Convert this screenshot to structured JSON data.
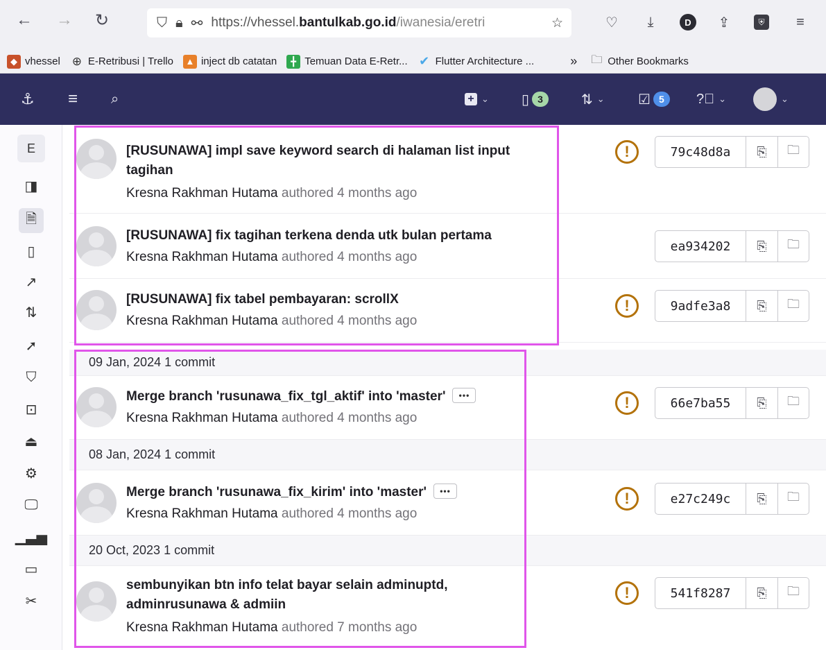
{
  "browser": {
    "url_prefix": "https://vhessel.",
    "url_host": "bantulkab.go.id",
    "url_path": "/iwanesia/eretri",
    "bookmarks": [
      {
        "label": "vhessel",
        "color": "#c8512a"
      },
      {
        "label": "E-Retribusi | Trello",
        "color": "#555555"
      },
      {
        "label": "inject db catatan",
        "color": "#e8802a"
      },
      {
        "label": "Temuan Data E-Retr...",
        "color": "#2fa84f"
      },
      {
        "label": "Flutter Architecture ...",
        "color": "#4aa8e8"
      }
    ],
    "overflow": "»",
    "other_bookmarks": "Other Bookmarks",
    "profile_letter": "D"
  },
  "gitlab": {
    "mr_count": "3",
    "todo_count": "5",
    "sidebar_project": "E"
  },
  "commits": [
    {
      "title_line1": "[RUSUNAWA] impl save keyword search di halaman list input",
      "title_line2": "tagihan",
      "author": "Kresna Rakhman Hutama",
      "authored": "authored 4 months ago",
      "sha": "79c48d8a",
      "pipeline": "warning"
    },
    {
      "title_line1": "[RUSUNAWA] fix tagihan terkena denda utk bulan pertama",
      "author": "Kresna Rakhman Hutama",
      "authored": "authored 4 months ago",
      "sha": "ea934202",
      "pipeline": "none"
    },
    {
      "title_line1": "[RUSUNAWA] fix tabel pembayaran: scrollX",
      "author": "Kresna Rakhman Hutama",
      "authored": "authored 4 months ago",
      "sha": "9adfe3a8",
      "pipeline": "warning"
    },
    {
      "date": "09 Jan, 2024 1 commit",
      "title_line1": "Merge branch 'rusunawa_fix_tgl_aktif' into 'master'",
      "author": "Kresna Rakhman Hutama",
      "authored": "authored 4 months ago",
      "sha": "66e7ba55",
      "pipeline": "warning"
    },
    {
      "date": "08 Jan, 2024 1 commit",
      "title_line1": "Merge branch 'rusunawa_fix_kirim' into 'master'",
      "author": "Kresna Rakhman Hutama",
      "authored": "authored 4 months ago",
      "sha": "e27c249c",
      "pipeline": "warning"
    },
    {
      "date": "20 Oct, 2023 1 commit",
      "title_line1": "sembunyikan btn info telat bayar selain adminuptd,",
      "title_line2": "adminrusunawa & admiin",
      "author": "Kresna Rakhman Hutama",
      "authored": "authored 7 months ago",
      "sha": "541f8287",
      "pipeline": "warning"
    }
  ],
  "colors": {
    "header": "#2e2e5e",
    "highlight": "#e055ea",
    "warning": "#b3720a"
  }
}
